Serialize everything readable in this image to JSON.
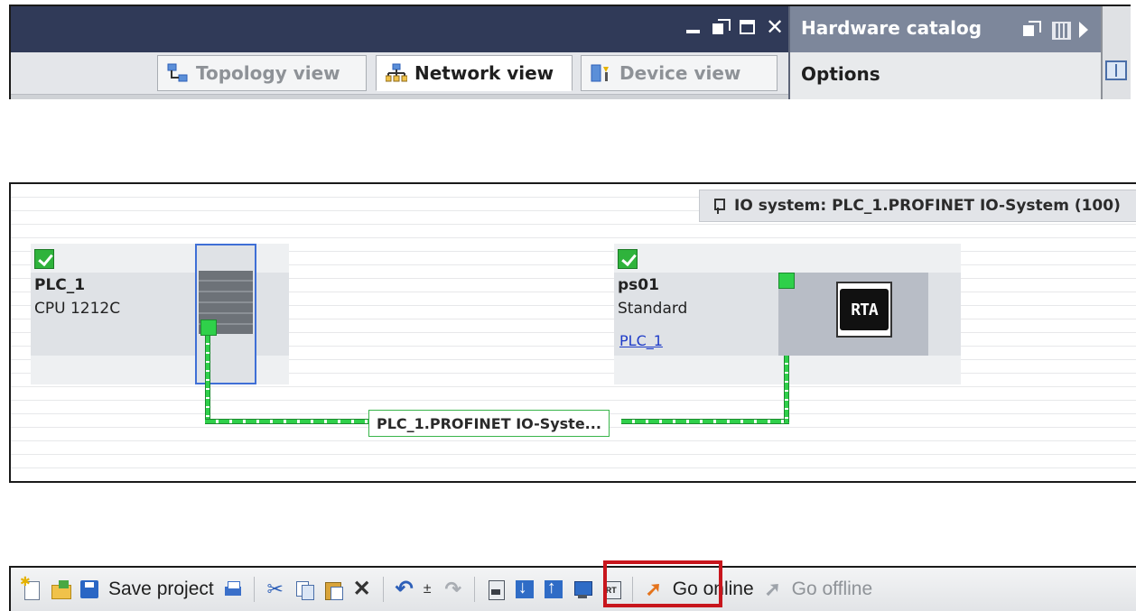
{
  "editor": {
    "tabs": {
      "topology": "Topology view",
      "network": "Network view",
      "device": "Device view"
    },
    "active_tab": "Network view"
  },
  "catalog": {
    "title": "Hardware catalog",
    "options_label": "Options"
  },
  "network": {
    "io_system_badge": "IO system: PLC_1.PROFINET IO-System (100)",
    "devices": [
      {
        "name": "PLC_1",
        "type": "CPU 1212C",
        "status": "ok"
      },
      {
        "name": "ps01",
        "type": "Standard",
        "assigned_controller": "PLC_1",
        "status": "ok",
        "logo_text": "RTA"
      }
    ],
    "subnet_label": "PLC_1.PROFINET IO-Syste..."
  },
  "toolbar": {
    "save_label": "Save project",
    "go_online_label": "Go online",
    "go_offline_label": "Go offline",
    "undo_pm": "±",
    "highlighted_group": [
      "compile",
      "download-to-device"
    ]
  },
  "colors": {
    "title_bar": "#303a58",
    "catalog_header": "#7d879b",
    "network_green": "#2fd04a",
    "highlight_red": "#c8161d",
    "link_blue": "#1e3cc8"
  },
  "icons": {
    "tab_topology": "topology-icon",
    "tab_network": "network-icon",
    "tab_device": "device-icon",
    "toolbar": [
      "new-project-icon",
      "open-project-icon",
      "save-icon",
      "print-icon",
      "cut-icon",
      "copy-icon",
      "paste-icon",
      "delete-icon",
      "undo-icon",
      "redo-icon",
      "compile-icon",
      "download-icon",
      "upload-icon",
      "simulation-icon",
      "runtime-icon",
      "go-online-icon",
      "go-offline-icon"
    ]
  }
}
